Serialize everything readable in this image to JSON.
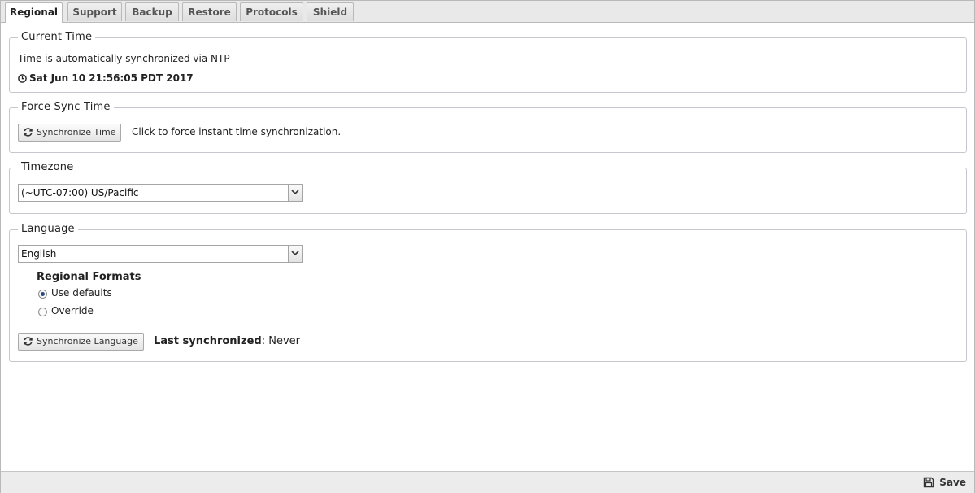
{
  "tabs": [
    "Regional",
    "Support",
    "Backup",
    "Restore",
    "Protocols",
    "Shield"
  ],
  "current_time": {
    "legend": "Current Time",
    "sync_text": "Time is automatically synchronized via NTP",
    "time": "Sat Jun 10 21:56:05 PDT 2017",
    "icon": "clock-icon"
  },
  "force_sync": {
    "legend": "Force Sync Time",
    "button": "Synchronize Time",
    "hint": "Click to force instant time synchronization.",
    "icon": "refresh-icon"
  },
  "timezone": {
    "legend": "Timezone",
    "selected": "(~UTC-07:00) US/Pacific"
  },
  "language": {
    "legend": "Language",
    "selected": "English",
    "formats_label": "Regional Formats",
    "options": [
      "Use defaults",
      "Override"
    ],
    "selected_option": "Use defaults",
    "button": "Synchronize Language",
    "last_sync_label": "Last synchronized",
    "last_sync_value": ": Never"
  },
  "footer": {
    "save": "Save",
    "icon": "floppy-disk-icon"
  },
  "colors": {
    "border": "#c6c6cf",
    "footer_bg": "#ececec",
    "radio_dot": "#2a4a80"
  }
}
